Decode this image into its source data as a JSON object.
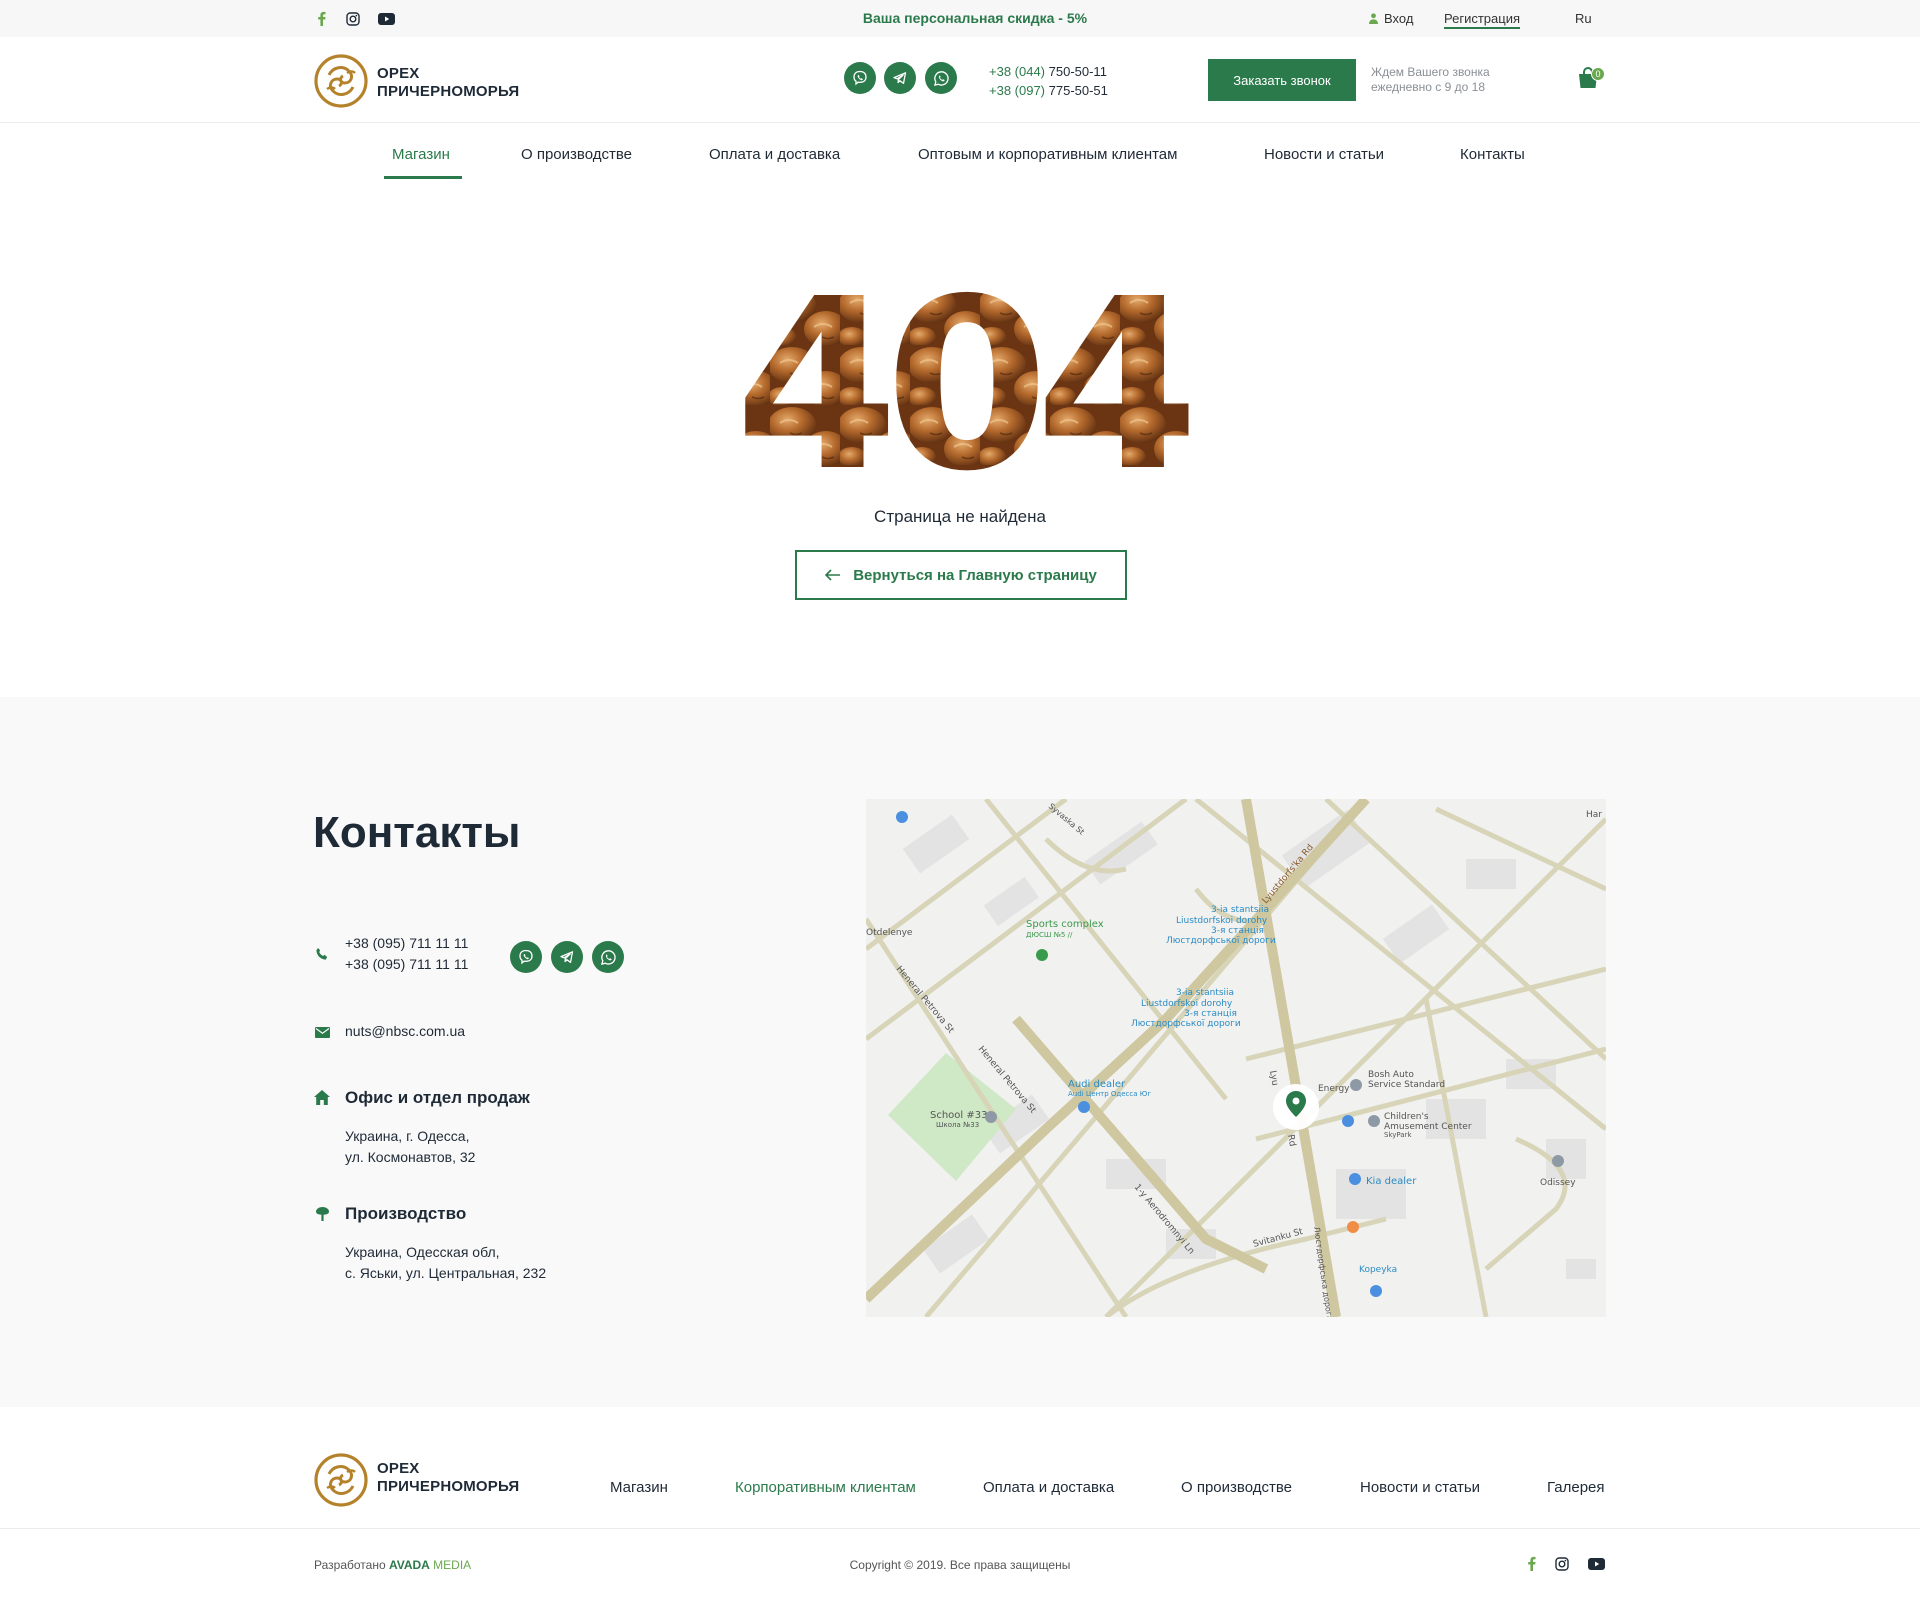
{
  "topbar": {
    "promo": "Ваша персональная скидка - 5%",
    "login": "Вход",
    "register": "Регистрация",
    "language": "Ru",
    "social": [
      "facebook-icon",
      "instagram-icon",
      "youtube-icon"
    ]
  },
  "header": {
    "logo_line1": "ОРЕХ",
    "logo_line2": "ПРИЧЕРНОМОРЬЯ",
    "phone1_code": "+38 (044)",
    "phone1_number": " 750-50-11",
    "phone2_code": "+38 (097)",
    "phone2_number": " 775-50-51",
    "call_button": "Заказать звонок",
    "call_note_line1": "Ждем Вашего звонка",
    "call_note_line2": "ежедневно с 9 до 18",
    "cart_count": "0",
    "messengers": [
      "viber-icon",
      "telegram-icon",
      "whatsapp-icon"
    ]
  },
  "nav": {
    "items": [
      "Магазин",
      "О производстве",
      "Оплата и доставка",
      "Оптовым и корпоративным клиентам",
      "Новости и статьи",
      "Контакты"
    ],
    "active": "Магазин"
  },
  "error": {
    "code": "404",
    "message": "Страница не найдена",
    "back_button": "Вернуться на Главную страницу"
  },
  "contacts": {
    "title": "Контакты",
    "phone1": "+38 (095) 711 11 11",
    "phone2": "+38 (095) 711 11 11",
    "email": "nuts@nbsc.com.ua",
    "office_title": "Офис и отдел продаж",
    "office_line1": "Украина, г. Одесса,",
    "office_line2": "ул. Космонавтов, 32",
    "production_title": "Производство",
    "production_line1": "Украина, Одесская обл,",
    "production_line2": "с. Яськи, ул. Центральная, 232"
  },
  "map": {
    "labels": {
      "sports": "Sports complex",
      "sports_sub": "ДЮСШ №5 //",
      "station1": "3-ia stantsiia",
      "station1b": "Liustdorfskoi dorohy",
      "station1c": "3-я станція",
      "station1d": "Люстдорфської дороги",
      "audi": "Audi dealer",
      "audi_sub": "Audi Центр Одесса Юг",
      "school": "School #33",
      "school_sub": "Школа №33",
      "bosh": "Bosh Auto",
      "bosh2": "Service Standard",
      "energy": "Energy",
      "childrens": "Children's",
      "amusement": "Amusement Center",
      "skypark": "SkyPark",
      "kia": "Kia dealer",
      "odissey": "Odissey",
      "kopeyka": "Kopeyka",
      "street1": "Heneral Petrova St",
      "street2": "Heneral Petrova St",
      "street3": "1-y Aerodromnyi Ln",
      "street4": "Lyustdorfs'ka Rd",
      "street5": "Svitanku St",
      "street6": "Syvaska St",
      "street7": "Lyu",
      "street8": "Rd",
      "street9": "Люстдорфська дорога",
      "otdelenye": "Otdelenye",
      "har": "Har"
    }
  },
  "footer": {
    "logo_line1": "ОРЕХ",
    "logo_line2": "ПРИЧЕРНОМОРЬЯ",
    "nav": [
      "Магазин",
      "Корпоративным клиентам",
      "Оплата и доставка",
      "О производстве",
      "Новости и статьи",
      "Галерея"
    ],
    "credits_prefix": "Разработано ",
    "credits_avada": "AVADA",
    "credits_media": " MEDIA",
    "copyright": "Copyright © 2019. Все права защищены",
    "social": [
      "facebook-icon",
      "instagram-icon",
      "youtube-icon"
    ]
  },
  "colors": {
    "brand_green": "#2b7a4b",
    "light_green": "#6aa84f",
    "logo_gold": "#b5822c",
    "dark_text": "#1f2a37"
  }
}
